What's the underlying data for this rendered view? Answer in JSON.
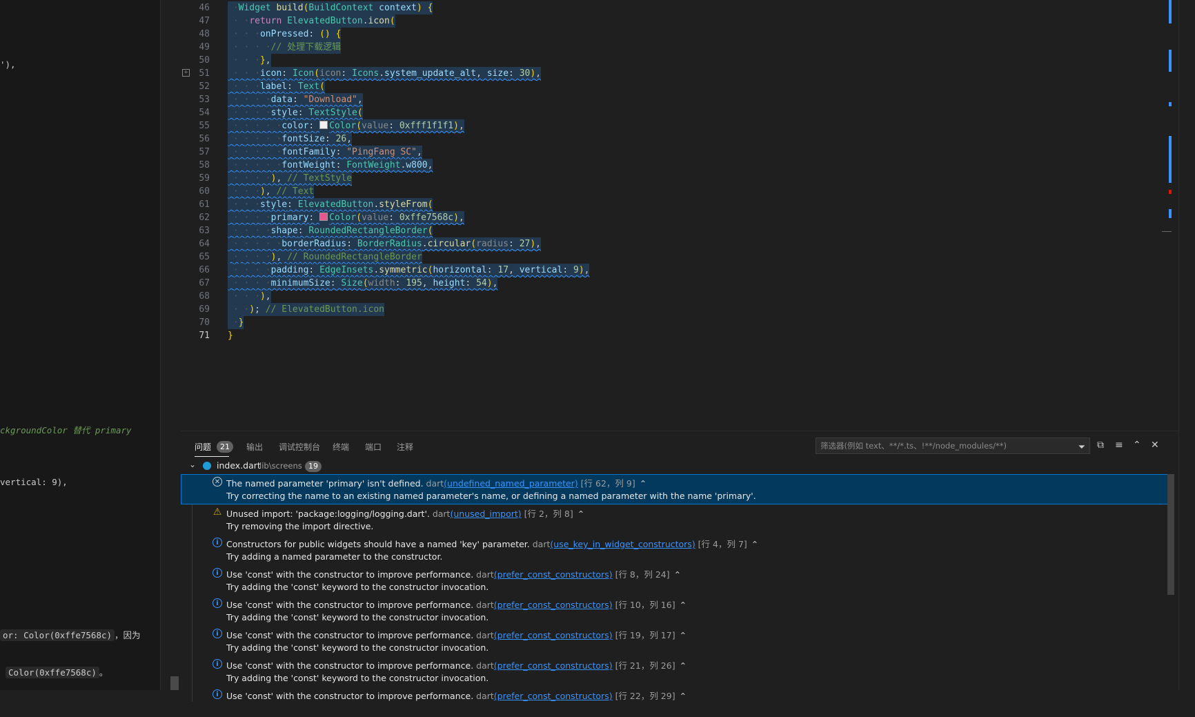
{
  "left_pane": {
    "lines": [
      {
        "text": "'),",
        "kind": "plain"
      },
      {
        "text": "ckgroundColor 替代 primary",
        "kind": "italic"
      },
      {
        "text": "vertical: 9),",
        "kind": "plain"
      },
      {
        "text": "or: Color(0xffe7568c)",
        "kind": "code",
        "suffix": "，因为"
      },
      {
        "text": "Color(0xffe7568c)",
        "kind": "code",
        "suffix": "。"
      }
    ]
  },
  "editor": {
    "active_line": 71,
    "lines": [
      {
        "num": "46",
        "text": "  Widget build(BuildContext context) {"
      },
      {
        "num": "47",
        "text": "    return ElevatedButton.icon("
      },
      {
        "num": "48",
        "text": "      onPressed: () {"
      },
      {
        "num": "49",
        "text": "        // 处理下载逻辑"
      },
      {
        "num": "50",
        "text": "      },"
      },
      {
        "num": "51",
        "text": "      icon: Icon(icon: Icons.system_update_alt, size: 30),"
      },
      {
        "num": "52",
        "text": "      label: Text("
      },
      {
        "num": "53",
        "text": "        data: \"Download\","
      },
      {
        "num": "54",
        "text": "        style: TextStyle("
      },
      {
        "num": "55",
        "text": "          color: Color(value: 0xfff1f1f1),"
      },
      {
        "num": "56",
        "text": "          fontSize: 26,"
      },
      {
        "num": "57",
        "text": "          fontFamily: \"PingFang SC\","
      },
      {
        "num": "58",
        "text": "          fontWeight: FontWeight.w800,"
      },
      {
        "num": "59",
        "text": "        ), // TextStyle"
      },
      {
        "num": "60",
        "text": "      ), // Text"
      },
      {
        "num": "61",
        "text": "      style: ElevatedButton.styleFrom("
      },
      {
        "num": "62",
        "text": "        primary: Color(value: 0xffe7568c),"
      },
      {
        "num": "63",
        "text": "        shape: RoundedRectangleBorder("
      },
      {
        "num": "64",
        "text": "          borderRadius: BorderRadius.circular(radius: 27),"
      },
      {
        "num": "65",
        "text": "        ), // RoundedRectangleBorder"
      },
      {
        "num": "66",
        "text": "        padding: EdgeInsets.symmetric(horizontal: 17, vertical: 9),"
      },
      {
        "num": "67",
        "text": "        minimumSize: Size(width: 195, height: 54),"
      },
      {
        "num": "68",
        "text": "      ),"
      },
      {
        "num": "69",
        "text": "    ); // ElevatedButton.icon"
      },
      {
        "num": "70",
        "text": "  }"
      },
      {
        "num": "71",
        "text": "}"
      }
    ],
    "swatch_colors": {
      "line55": "#f1f1f1",
      "line62": "#e7568c"
    }
  },
  "panel": {
    "tabs": [
      {
        "label": "问题",
        "badge": "21",
        "active": true
      },
      {
        "label": "输出"
      },
      {
        "label": "调试控制台"
      },
      {
        "label": "终端"
      },
      {
        "label": "端口"
      },
      {
        "label": "注释"
      }
    ],
    "filter_placeholder": "筛选器(例如 text、**/*.ts、!**/node_modules/**)",
    "file": {
      "name": "index.dart",
      "path": "lib\\screens",
      "count": "19"
    },
    "problems": [
      {
        "severity": "error",
        "message": "The named parameter 'primary' isn't defined.",
        "source": "dart",
        "code": "undefined_named_parameter",
        "location": "[行 62，列 9]",
        "hint": "Try correcting the name to an existing named parameter's name, or defining a named parameter with the name 'primary'.",
        "selected": true
      },
      {
        "severity": "warning",
        "message": "Unused import: 'package:logging/logging.dart'.",
        "source": "dart",
        "code": "unused_import",
        "location": "[行 2，列 8]",
        "hint": "Try removing the import directive."
      },
      {
        "severity": "info",
        "message": "Constructors for public widgets should have a named 'key' parameter.",
        "source": "dart",
        "code": "use_key_in_widget_constructors",
        "location": "[行 4，列 7]",
        "hint": "Try adding a named parameter to the constructor."
      },
      {
        "severity": "info",
        "message": "Use 'const' with the constructor to improve performance.",
        "source": "dart",
        "code": "prefer_const_constructors",
        "location": "[行 8，列 24]",
        "hint": "Try adding the 'const' keyword to the constructor invocation."
      },
      {
        "severity": "info",
        "message": "Use 'const' with the constructor to improve performance.",
        "source": "dart",
        "code": "prefer_const_constructors",
        "location": "[行 10，列 16]",
        "hint": "Try adding the 'const' keyword to the constructor invocation."
      },
      {
        "severity": "info",
        "message": "Use 'const' with the constructor to improve performance.",
        "source": "dart",
        "code": "prefer_const_constructors",
        "location": "[行 19，列 17]",
        "hint": "Try adding the 'const' keyword to the constructor invocation."
      },
      {
        "severity": "info",
        "message": "Use 'const' with the constructor to improve performance.",
        "source": "dart",
        "code": "prefer_const_constructors",
        "location": "[行 21，列 26]",
        "hint": "Try adding the 'const' keyword to the constructor invocation."
      },
      {
        "severity": "info",
        "message": "Use 'const' with the constructor to improve performance.",
        "source": "dart",
        "code": "prefer_const_constructors",
        "location": "[行 22，列 29]",
        "hint": ""
      }
    ],
    "icons": [
      "filter-icon",
      "collapse-all-icon",
      "word-wrap-icon",
      "maximize-panel-icon",
      "close-panel-icon"
    ]
  }
}
